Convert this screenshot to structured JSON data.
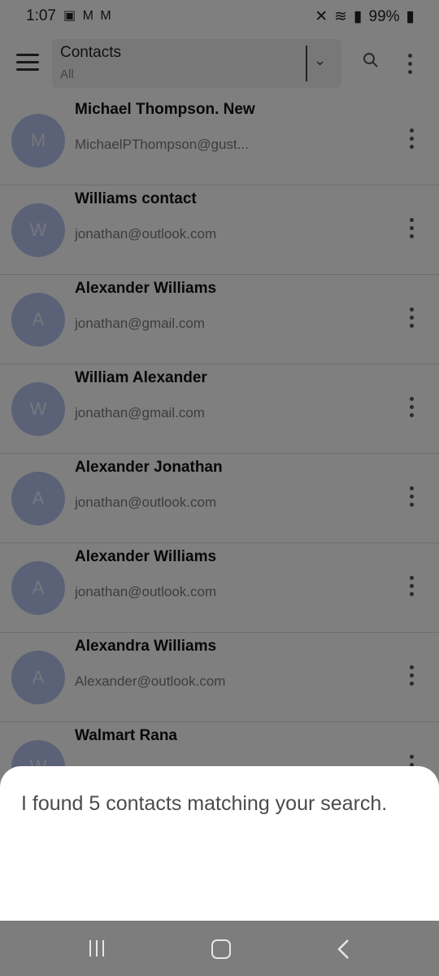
{
  "status_bar": {
    "time": "1:07",
    "battery": "99%",
    "notification_icons": [
      "image-icon",
      "gmail-icon",
      "gmail-icon"
    ]
  },
  "app_bar": {
    "title": "Contacts",
    "subtitle": "All"
  },
  "contacts": [
    {
      "initial": "M",
      "name": "Michael Thompson. New",
      "email": "MichaelPThompson@gust..."
    },
    {
      "initial": "W",
      "name": "Williams contact",
      "email": "jonathan@outlook.com"
    },
    {
      "initial": "A",
      "name": "Alexander Williams",
      "email": "jonathan@gmail.com"
    },
    {
      "initial": "W",
      "name": "William Alexander",
      "email": "jonathan@gmail.com"
    },
    {
      "initial": "A",
      "name": "Alexander Jonathan",
      "email": "jonathan@outlook.com"
    },
    {
      "initial": "A",
      "name": "Alexander Williams",
      "email": "jonathan@outlook.com"
    },
    {
      "initial": "A",
      "name": "Alexandra Williams",
      "email": "Alexander@outlook.com"
    },
    {
      "initial": "W",
      "name": "Walmart Rana",
      "email": ""
    }
  ],
  "assistant_sheet": {
    "message": "I found 5 contacts matching your search."
  },
  "colors": {
    "avatar_bg": "#b7c5ee",
    "scrim": "rgba(0,0,0,0.5)",
    "navbar_bg": "#7d7d7d"
  }
}
